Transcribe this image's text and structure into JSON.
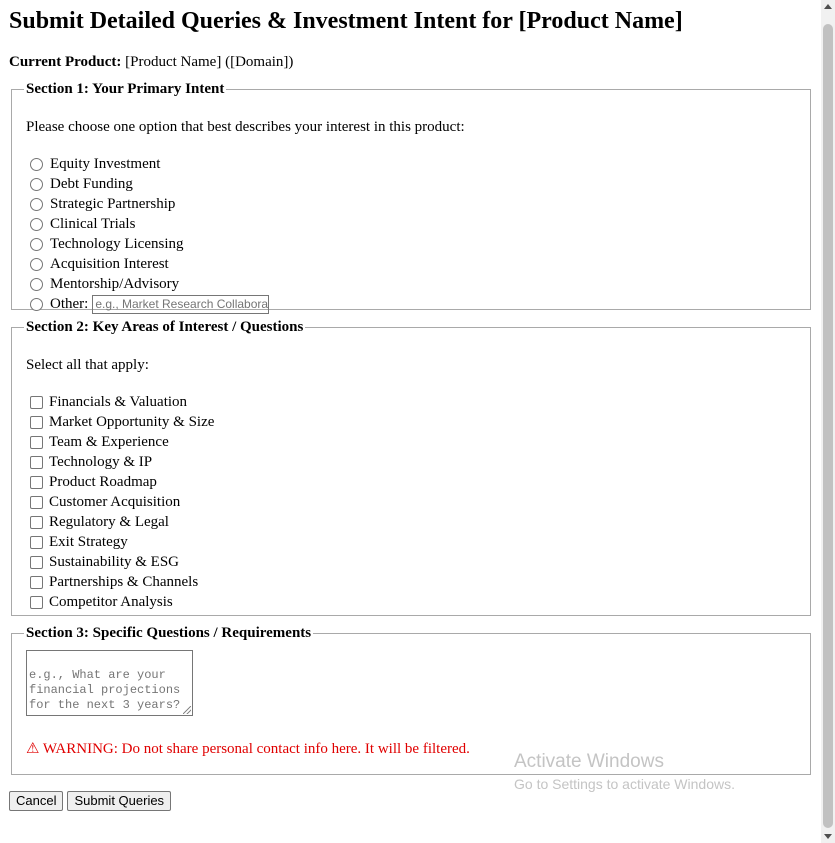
{
  "page_title": "Submit Detailed Queries & Investment Intent for [Product Name]",
  "current_product": {
    "label": "Current Product:",
    "value": "[Product Name] ([Domain])"
  },
  "section1": {
    "legend": "Section 1: Your Primary Intent",
    "instruction": "Please choose one option that best describes your interest in this product:",
    "options": [
      "Equity Investment",
      "Debt Funding",
      "Strategic Partnership",
      "Clinical Trials",
      "Technology Licensing",
      "Acquisition Interest",
      "Mentorship/Advisory"
    ],
    "other_label": "Other:",
    "other_placeholder": "e.g., Market Research Collaboration"
  },
  "section2": {
    "legend": "Section 2: Key Areas of Interest / Questions",
    "instruction": "Select all that apply:",
    "options": [
      "Financials & Valuation",
      "Market Opportunity & Size",
      "Team & Experience",
      "Technology & IP",
      "Product Roadmap",
      "Customer Acquisition",
      "Regulatory & Legal",
      "Exit Strategy",
      "Sustainability & ESG",
      "Partnerships & Channels",
      "Competitor Analysis"
    ]
  },
  "section3": {
    "legend": "Section 3: Specific Questions / Requirements",
    "placeholder": "e.g., What are your financial projections for the next 3 years?",
    "warning": "⚠ WARNING: Do not share personal contact info here. It will be filtered."
  },
  "buttons": {
    "cancel": "Cancel",
    "submit": "Submit Queries"
  },
  "watermark": {
    "line1": "Activate Windows",
    "line2": "Go to Settings to activate Windows."
  },
  "colors": {
    "warning": "#e00000",
    "placeholder": "#757575",
    "border": "#a9a9a9"
  }
}
